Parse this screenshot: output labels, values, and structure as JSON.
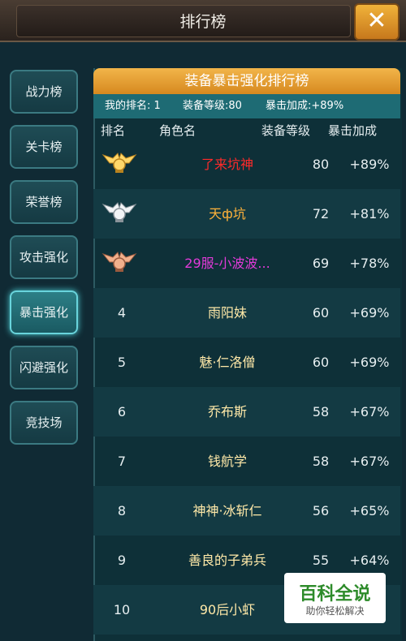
{
  "window": {
    "title": "排行榜",
    "close_label": "✕"
  },
  "sidebar": {
    "items": [
      {
        "label": "战力榜"
      },
      {
        "label": "关卡榜"
      },
      {
        "label": "荣誉榜"
      },
      {
        "label": "攻击强化"
      },
      {
        "label": "暴击强化",
        "active": true
      },
      {
        "label": "闪避强化"
      },
      {
        "label": "竞技场"
      }
    ]
  },
  "board": {
    "title": "装备暴击强化排行榜",
    "my_rank_label": "我的排名: 1",
    "my_level_label": "装备等级:80",
    "my_crit_label": "暴击加成:+89%",
    "columns": {
      "rank": "排名",
      "name": "角色名",
      "level": "装备等级",
      "crit": "暴击加成"
    },
    "rows": [
      {
        "rank": "",
        "medal": "gold",
        "name": "了来坑神",
        "name_color": "#ff2a2a",
        "level": "80",
        "crit": "+89%"
      },
      {
        "rank": "",
        "medal": "silver",
        "name": "天ф坑",
        "name_color": "#ffb23a",
        "level": "72",
        "crit": "+81%"
      },
      {
        "rank": "",
        "medal": "bronze",
        "name": "29服-小波波...",
        "name_color": "#e23ad9",
        "level": "69",
        "crit": "+78%"
      },
      {
        "rank": "4",
        "name": "雨阳妹",
        "level": "60",
        "crit": "+69%"
      },
      {
        "rank": "5",
        "name": "魅·仁洛僧",
        "level": "60",
        "crit": "+69%"
      },
      {
        "rank": "6",
        "name": "乔布斯",
        "level": "58",
        "crit": "+67%"
      },
      {
        "rank": "7",
        "name": "钱航学",
        "level": "58",
        "crit": "+67%"
      },
      {
        "rank": "8",
        "name": "神神·冰斩仁",
        "level": "56",
        "crit": "+65%"
      },
      {
        "rank": "9",
        "name": "善良的子弟兵",
        "level": "55",
        "crit": "+64%"
      },
      {
        "rank": "10",
        "name": "90后小虾",
        "level": "",
        "crit": ""
      }
    ]
  },
  "watermark": {
    "line1": "百科全说",
    "line2": "助你轻松解决"
  }
}
